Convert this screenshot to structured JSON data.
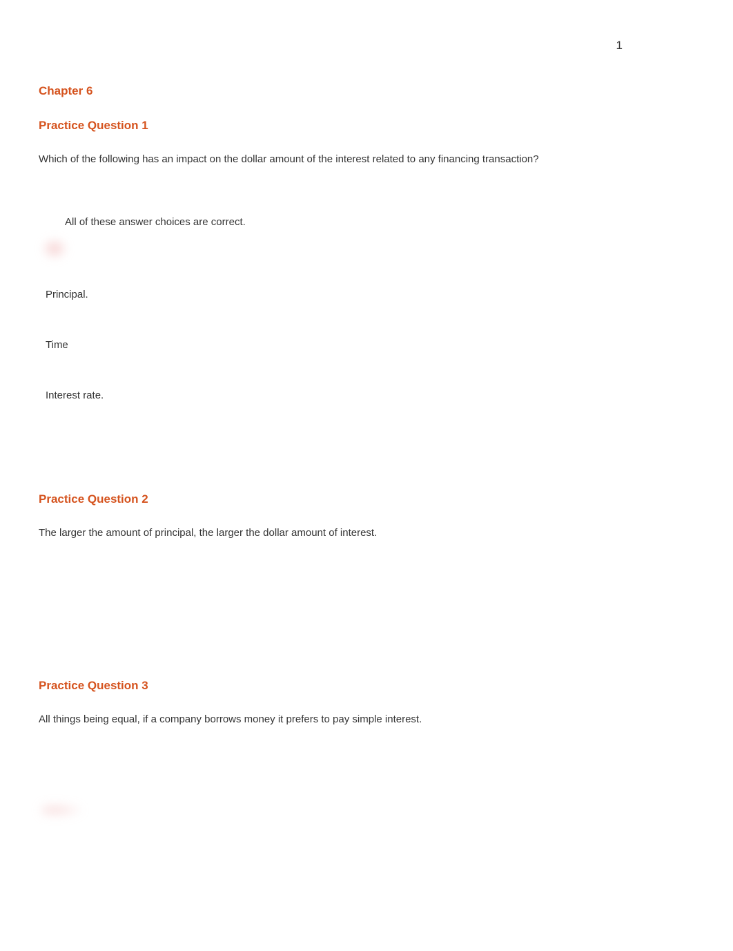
{
  "page_number": "1",
  "chapter_title": "Chapter 6",
  "questions": [
    {
      "title": "Practice Question 1",
      "text": "Which of the following has an impact on the dollar amount of the interest related to any financing transaction?",
      "options": [
        "All of these answer choices are correct.",
        "Principal.",
        "Time",
        "Interest rate."
      ]
    },
    {
      "title": "Practice Question 2",
      "text": "The larger the amount of principal, the larger the dollar amount of interest."
    },
    {
      "title": "Practice Question 3",
      "text": "All things being equal, if a company borrows money it prefers to pay simple interest."
    }
  ]
}
